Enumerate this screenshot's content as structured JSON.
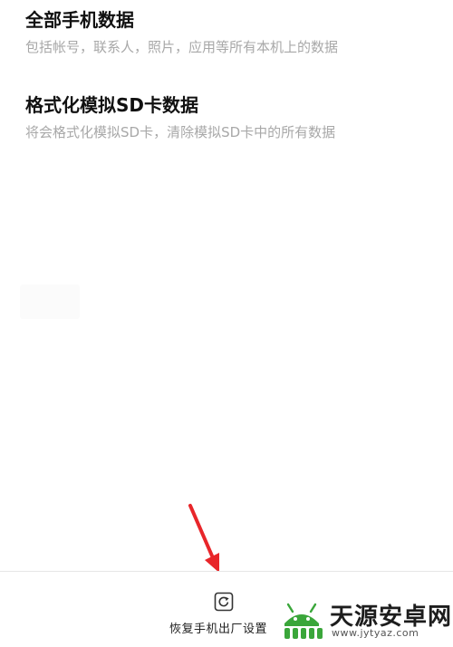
{
  "sections": [
    {
      "title": "全部手机数据",
      "subtitle": "包括帐号，联系人，照片，应用等所有本机上的数据"
    },
    {
      "title": "格式化模拟SD卡数据",
      "subtitle": "将会格式化模拟SD卡，清除模拟SD卡中的所有数据"
    }
  ],
  "bottom_bar": {
    "reset_label": "恢复手机出厂设置",
    "reset_icon": "restore-icon"
  },
  "annotation": {
    "arrow_color": "#e8262a"
  },
  "watermark": {
    "name": "天源安卓网",
    "url": "www.jytyaz.com",
    "brand_color": "#3aa63a"
  }
}
